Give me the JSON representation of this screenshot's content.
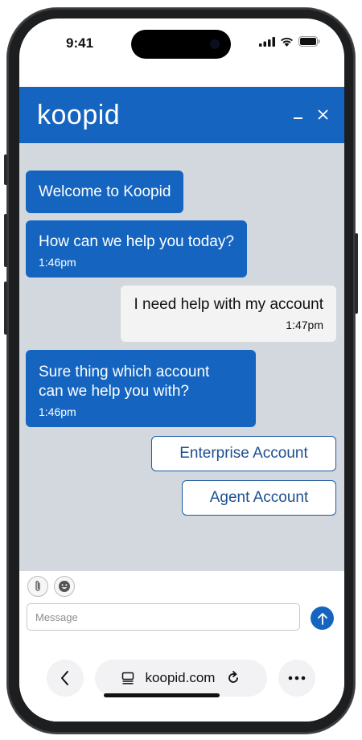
{
  "status_bar": {
    "time": "9:41"
  },
  "header": {
    "logo_text": "koopid"
  },
  "messages": [
    {
      "from": "bot",
      "text": "Welcome to Koopid",
      "time": ""
    },
    {
      "from": "bot",
      "text": "How can we help you today?",
      "time": "1:46pm"
    },
    {
      "from": "user",
      "text": "I need help with my account",
      "time": "1:47pm"
    },
    {
      "from": "bot",
      "text_line1": "Sure thing which account",
      "text_line2": "can we help you with?",
      "time": "1:46pm"
    }
  ],
  "quick_replies": [
    {
      "label": "Enterprise Account"
    },
    {
      "label": "Agent Account"
    }
  ],
  "composer": {
    "placeholder": "Message"
  },
  "browser": {
    "url": "koopid.com"
  },
  "icons": {
    "signal": "signal-icon",
    "wifi": "wifi-icon",
    "battery": "battery-icon",
    "minimize": "minimize-icon",
    "close": "close-icon",
    "attach": "paperclip-icon",
    "emoji": "emoji-icon",
    "send": "send-arrow-icon",
    "back": "chevron-left-icon",
    "tabs": "tabs-icon",
    "reload": "reload-icon",
    "more": "more-icon"
  },
  "colors": {
    "brand_blue": "#1565c0",
    "chat_bg": "#d3d8df",
    "user_bubble": "#f3f3f3",
    "quick_border": "#1e5aa6"
  }
}
